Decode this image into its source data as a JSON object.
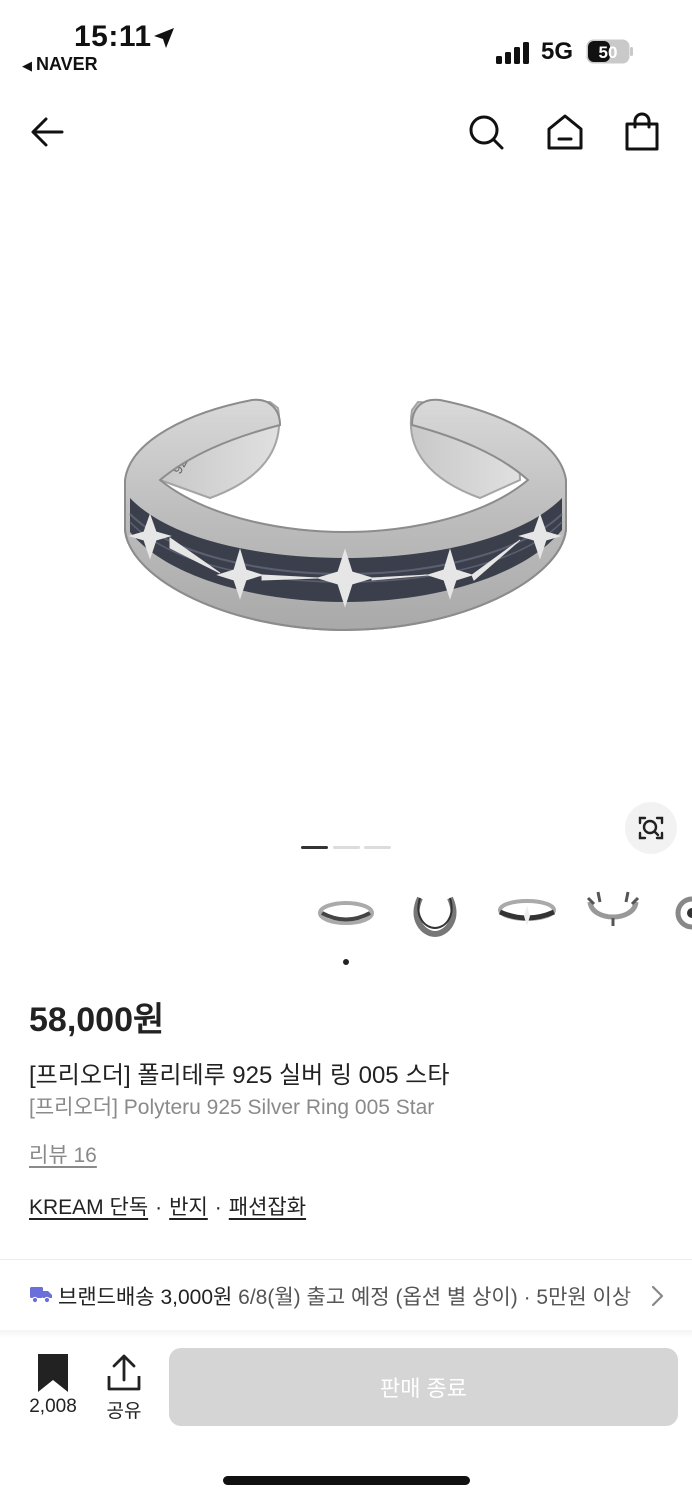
{
  "status_bar": {
    "time": "15:11",
    "back_app": "NAVER",
    "network": "5G",
    "battery": "50",
    "icons": [
      "location-arrow-icon",
      "signal-icon",
      "battery-icon"
    ]
  },
  "nav": {
    "icons": [
      "back-arrow-icon",
      "search-icon",
      "home-icon",
      "shopping-bag-icon"
    ]
  },
  "gallery": {
    "page_count": 3,
    "active_page": 1,
    "thumbnail_count": 5,
    "lens_icon": "image-search-icon"
  },
  "product": {
    "price": "58,000원",
    "name_ko": "[프리오더] 폴리테루 925 실버 링 005 스타",
    "name_en": "[프리오더] Polyteru 925 Silver Ring 005 Star",
    "review": "리뷰 16",
    "tags": [
      "KREAM 단독",
      "반지",
      "패션잡화"
    ],
    "tag_separator": "·"
  },
  "shipping": {
    "icon": "truck-icon",
    "label": "브랜드배송",
    "fee": "3,000원",
    "date": "6/8(월) 출고 예정 (옵션 별 상이)",
    "sep": "·",
    "extra": "5만원 이상"
  },
  "bottom_bar": {
    "bookmark_count": "2,008",
    "share_label": "공유",
    "cta_label": "판매 종료"
  },
  "colors": {
    "accent_purple": "#6b6fd9",
    "cta_disabled": "#d5d5d5"
  }
}
